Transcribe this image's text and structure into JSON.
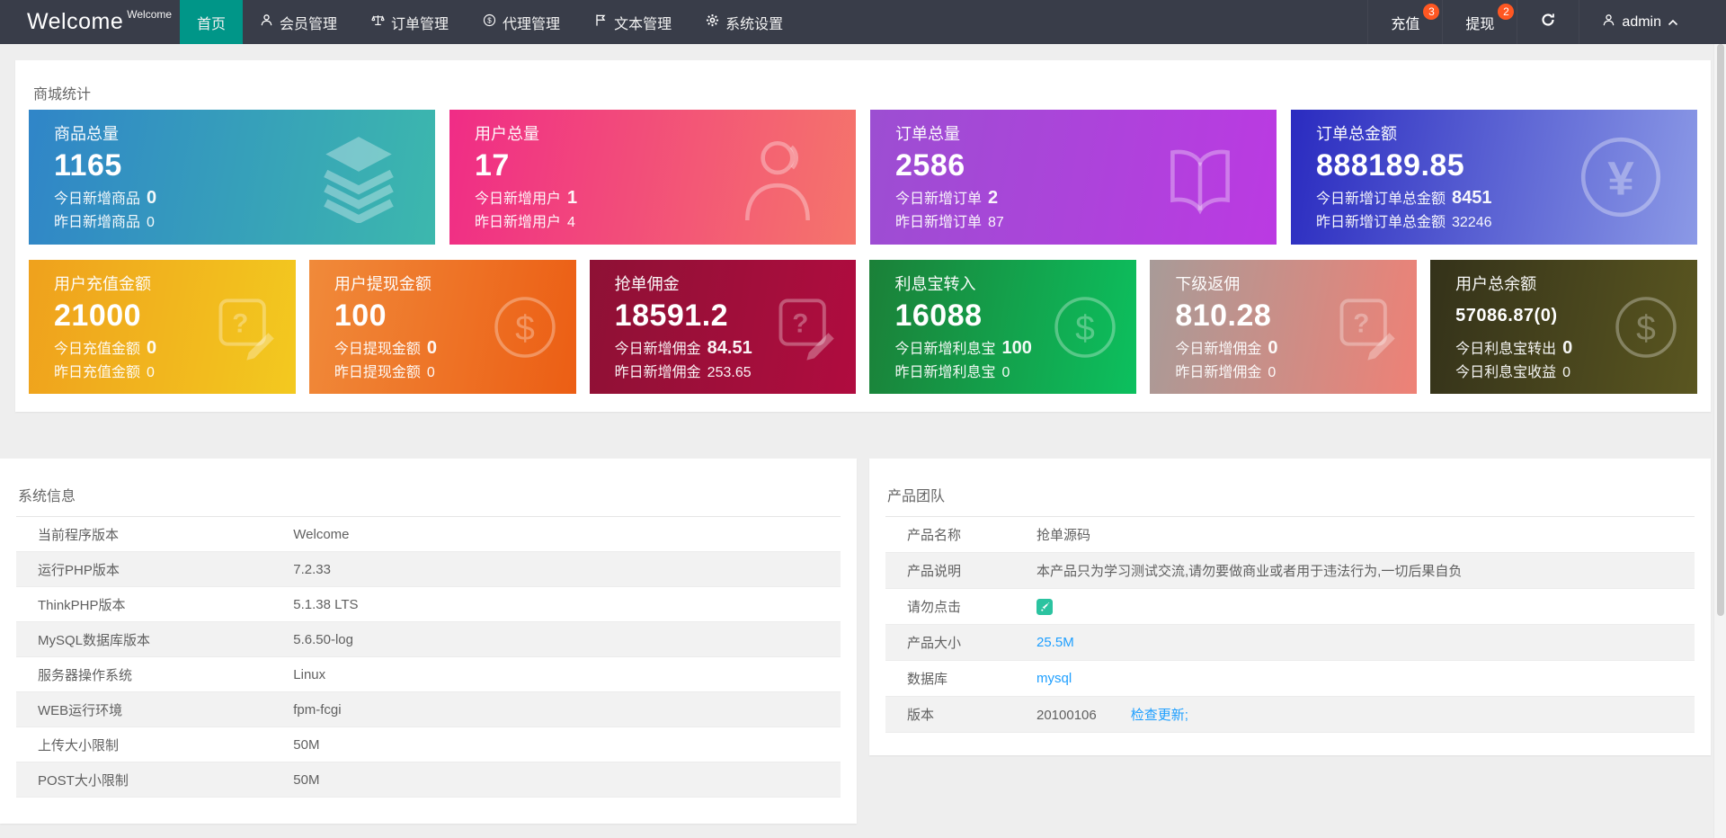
{
  "navbar": {
    "logo_main": "Welcome",
    "logo_sup": "Welcome",
    "menu": [
      {
        "label": "首页",
        "active": true
      },
      {
        "label": "会员管理",
        "icon": "user-icon"
      },
      {
        "label": "订单管理",
        "icon": "scales-icon"
      },
      {
        "label": "代理管理",
        "icon": "dollar-circle-icon"
      },
      {
        "label": "文本管理",
        "icon": "flag-icon"
      },
      {
        "label": "系统设置",
        "icon": "gear-icon"
      }
    ],
    "recharge_label": "充值",
    "recharge_badge": "3",
    "withdraw_label": "提现",
    "withdraw_badge": "2",
    "username": "admin"
  },
  "colors": {
    "navbar_bg": "#393d49",
    "active_menu": "#009688",
    "badge": "#ff5722",
    "link": "#1e9fff",
    "page_bg": "#eeeeee",
    "panel_bg": "#ffffff"
  },
  "stats": {
    "title": "商城统计",
    "row1": [
      {
        "title": "商品总量",
        "value": "1165",
        "today_label": "今日新增商品",
        "today_value": "0",
        "yesterday_label": "昨日新增商品",
        "yesterday_value": "0",
        "icon": "layers-icon",
        "gradient": [
          "#3085c8",
          "#3cb8ad"
        ]
      },
      {
        "title": "用户总量",
        "value": "17",
        "today_label": "今日新增用户",
        "today_value": "1",
        "yesterday_label": "昨日新增用户",
        "yesterday_value": "4",
        "icon": "person-icon",
        "gradient": [
          "#f02c86",
          "#f5756b"
        ]
      },
      {
        "title": "订单总量",
        "value": "2586",
        "today_label": "今日新增订单",
        "today_value": "2",
        "yesterday_label": "昨日新增订单",
        "yesterday_value": "87",
        "icon": "book-icon",
        "gradient": [
          "#9c4ed2",
          "#bb3ae2"
        ]
      },
      {
        "title": "订单总金额",
        "value": "888189.85",
        "today_label": "今日新增订单总金额",
        "today_value": "8451",
        "yesterday_label": "昨日新增订单总金额",
        "yesterday_value": "32246",
        "icon": "yen-circle-icon",
        "gradient": [
          "#2a2bc0",
          "#8b99e6"
        ]
      }
    ],
    "row2": [
      {
        "title": "用户充值金额",
        "value": "21000",
        "today_label": "今日充值金额",
        "today_value": "0",
        "yesterday_label": "昨日充值金额",
        "yesterday_value": "0",
        "icon": "help-edit-icon",
        "gradient": [
          "#efa11d",
          "#f3c91f"
        ]
      },
      {
        "title": "用户提现金额",
        "value": "100",
        "today_label": "今日提现金额",
        "today_value": "0",
        "yesterday_label": "昨日提现金额",
        "yesterday_value": "0",
        "icon": "dollar-circle-icon",
        "gradient": [
          "#f08a3a",
          "#ec5e14"
        ]
      },
      {
        "title": "抢单佣金",
        "value": "18591.2",
        "today_label": "今日新增佣金",
        "today_value": "84.51",
        "yesterday_label": "昨日新增佣金",
        "yesterday_value": "253.65",
        "icon": "help-edit-icon",
        "gradient": [
          "#8e1135",
          "#b00c3f"
        ]
      },
      {
        "title": "利息宝转入",
        "value": "16088",
        "today_label": "今日新增利息宝",
        "today_value": "100",
        "yesterday_label": "昨日新增利息宝",
        "yesterday_value": "0",
        "icon": "dollar-circle-icon",
        "gradient": [
          "#1b8038",
          "#0cc05e"
        ]
      },
      {
        "title": "下级返佣",
        "value": "810.28",
        "today_label": "今日新增佣金",
        "today_value": "0",
        "yesterday_label": "昨日新增佣金",
        "yesterday_value": "0",
        "icon": "help-edit-icon",
        "gradient": [
          "#a89b98",
          "#ee8176"
        ]
      },
      {
        "title": "用户总余额",
        "value": "57086.87(0)",
        "today_label": "今日利息宝转出",
        "today_value": "0",
        "yesterday_label": "今日利息宝收益",
        "yesterday_value": "0",
        "icon": "dollar-circle-icon",
        "gradient": [
          "#34321a",
          "#5a5620"
        ]
      }
    ]
  },
  "system_info": {
    "title": "系统信息",
    "rows": [
      {
        "label": "当前程序版本",
        "value": "Welcome"
      },
      {
        "label": "运行PHP版本",
        "value": "7.2.33"
      },
      {
        "label": "ThinkPHP版本",
        "value": "5.1.38 LTS"
      },
      {
        "label": "MySQL数据库版本",
        "value": "5.6.50-log"
      },
      {
        "label": "服务器操作系统",
        "value": "Linux"
      },
      {
        "label": "WEB运行环境",
        "value": "fpm-fcgi"
      },
      {
        "label": "上传大小限制",
        "value": "50M"
      },
      {
        "label": "POST大小限制",
        "value": "50M"
      }
    ]
  },
  "product_team": {
    "title": "产品团队",
    "rows": [
      {
        "label": "产品名称",
        "value": "抢单源码"
      },
      {
        "label": "产品说明",
        "value": "本产品只为学习测试交流,请勿要做商业或者用于违法行为,一切后果自负"
      },
      {
        "label": "请勿点击",
        "value": "",
        "icon": "rocket-icon"
      },
      {
        "label": "产品大小",
        "value": "25.5M",
        "link": true
      },
      {
        "label": "数据库",
        "value": "mysql",
        "link": true
      },
      {
        "label": "版本",
        "value": "20100106",
        "link_text": "检查更新;"
      }
    ]
  }
}
